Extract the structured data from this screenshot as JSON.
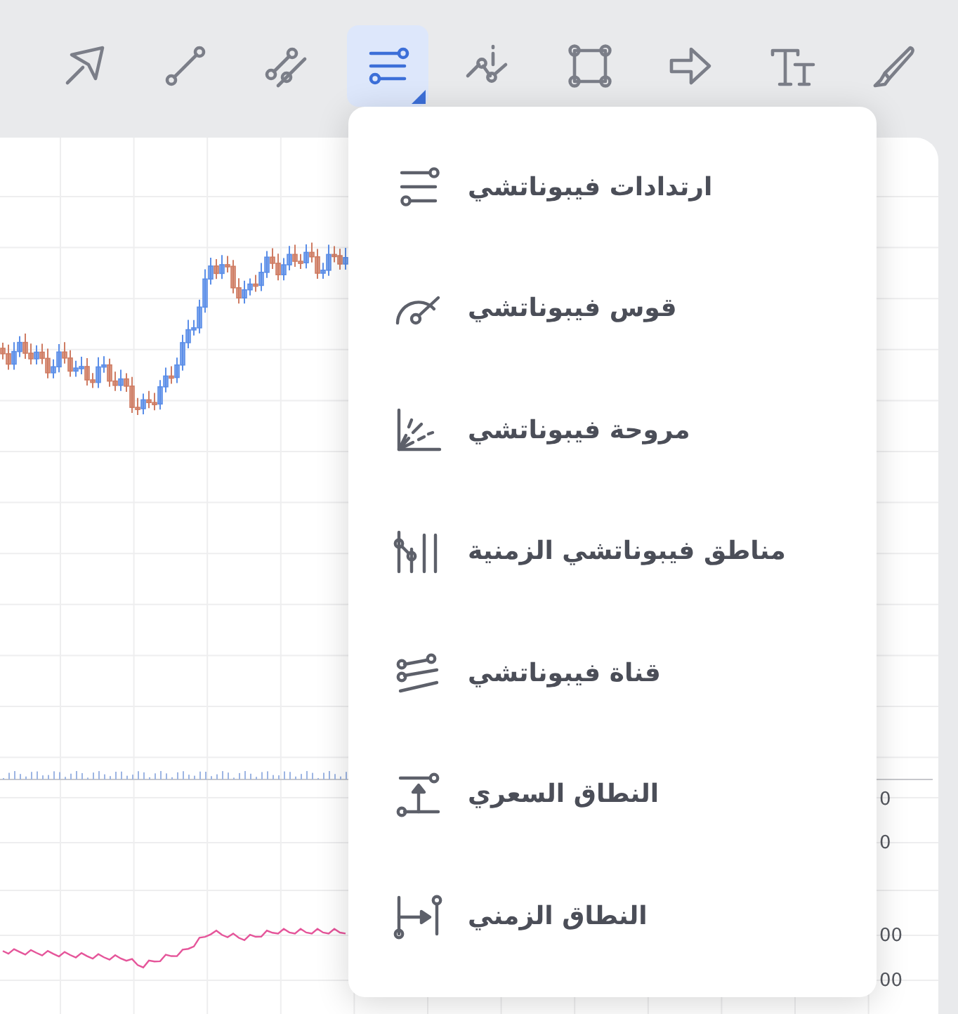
{
  "toolbar": [
    {
      "selected": false
    },
    {
      "selected": false
    },
    {
      "selected": false
    },
    {
      "selected": true
    },
    {
      "selected": false
    },
    {
      "selected": false
    },
    {
      "selected": false
    },
    {
      "selected": false
    },
    {
      "selected": false
    }
  ],
  "fibonacci_menu": {
    "items": [
      {
        "label": "ارتدادات فيبوناتشي"
      },
      {
        "label": "قوس فيبوناتشي"
      },
      {
        "label": "مروحة فيبوناتشي"
      },
      {
        "label": "مناطق فيبوناتشي الزمنية"
      },
      {
        "label": "قناة فيبوناتشي"
      },
      {
        "label": "النطاق السعري"
      },
      {
        "label": "النطاق الزمني"
      }
    ]
  },
  "price_axis_labels": [
    "0",
    "0",
    "00",
    "00"
  ]
}
